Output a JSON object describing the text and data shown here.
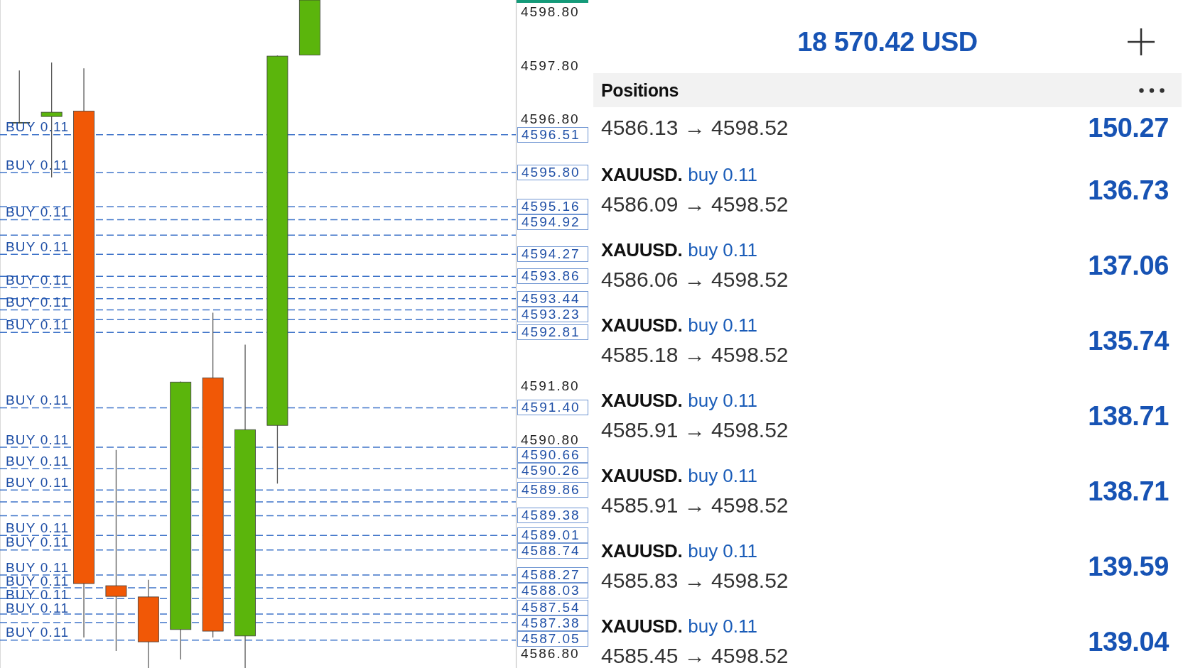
{
  "chart": {
    "chart_data": {
      "type": "candlestick",
      "categories": [
        null,
        null,
        null,
        null,
        null,
        null,
        null,
        null,
        null,
        null
      ],
      "ylim": [
        4586.53,
        4599.03
      ],
      "yticks": [
        {
          "value": 4598.8,
          "label": "4598.80"
        },
        {
          "value": 4597.8,
          "label": "4597.80"
        },
        {
          "value": 4596.8,
          "label": "4596.80"
        },
        {
          "value": 4591.8,
          "label": "4591.80"
        },
        {
          "value": 4590.8,
          "label": "4590.80"
        },
        {
          "value": 4586.8,
          "label": "4586.80"
        }
      ],
      "ref_lines": [
        {
          "axis": "y",
          "value": 4596.51,
          "label": "BUY 0.11"
        },
        {
          "axis": "y",
          "value": 4595.8,
          "label": "BUY 0.11"
        },
        {
          "axis": "y",
          "value": 4595.16
        },
        {
          "axis": "y",
          "value": 4594.92,
          "label": "BUY 0.11"
        },
        {
          "axis": "y",
          "value": 4594.63
        },
        {
          "axis": "y",
          "value": 4594.27,
          "label": "BUY 0.11"
        },
        {
          "axis": "y",
          "value": 4593.86
        },
        {
          "axis": "y",
          "value": 4593.65,
          "label": "BUY 0.11"
        },
        {
          "axis": "y",
          "value": 4593.44
        },
        {
          "axis": "y",
          "value": 4593.23,
          "label": "BUY 0.11"
        },
        {
          "axis": "y",
          "value": 4593.05
        },
        {
          "axis": "y",
          "value": 4592.81,
          "label": "BUY 0.11"
        },
        {
          "axis": "y",
          "value": 4591.4,
          "label": "BUY 0.11"
        },
        {
          "axis": "y",
          "value": 4590.66,
          "label": "BUY 0.11"
        },
        {
          "axis": "y",
          "value": 4590.26,
          "label": "BUY 0.11"
        },
        {
          "axis": "y",
          "value": 4589.86,
          "label": "BUY 0.11"
        },
        {
          "axis": "y",
          "value": 4589.64
        },
        {
          "axis": "y",
          "value": 4589.38
        },
        {
          "axis": "y",
          "value": 4589.01,
          "label": "BUY 0.11"
        },
        {
          "axis": "y",
          "value": 4588.74,
          "label": "BUY 0.11"
        },
        {
          "axis": "y",
          "value": 4588.27,
          "label": "BUY 0.11"
        },
        {
          "axis": "y",
          "value": 4588.03,
          "label": "BUY 0.11"
        },
        {
          "axis": "y",
          "value": 4587.83,
          "label": "BUY 0.11"
        },
        {
          "axis": "y",
          "value": 4587.54,
          "label": "BUY 0.11"
        },
        {
          "axis": "y",
          "value": 4587.38
        },
        {
          "axis": "y",
          "value": 4587.05,
          "label": "BUY 0.11"
        }
      ],
      "annotations": [
        "4596.51",
        "4595.80",
        "4595.16",
        "4594.92",
        "4594.27",
        "4593.86",
        "4593.44",
        "4593.23",
        "4592.81",
        "4591.40",
        "4590.66",
        "4590.26",
        "4589.86",
        "4589.38",
        "4589.01",
        "4588.74",
        "4588.27",
        "4588.03",
        "4587.54",
        "4587.38",
        "4587.05"
      ]
    }
  },
  "account": {
    "balance": "18 570.42 USD"
  },
  "positions": {
    "title": "Positions",
    "rows": [
      {
        "prices": "4586.13 → 4598.52",
        "profit": "150.27"
      },
      {
        "symbol": "XAUUSD.",
        "order": "buy 0.11",
        "prices": "4586.09 → 4598.52",
        "profit": "136.73"
      },
      {
        "symbol": "XAUUSD.",
        "order": "buy 0.11",
        "prices": "4586.06 → 4598.52",
        "profit": "137.06"
      },
      {
        "symbol": "XAUUSD.",
        "order": "buy 0.11",
        "prices": "4585.18 → 4598.52",
        "profit": "135.74"
      },
      {
        "symbol": "XAUUSD.",
        "order": "buy 0.11",
        "prices": "4585.91 → 4598.52",
        "profit": "138.71"
      },
      {
        "symbol": "XAUUSD.",
        "order": "buy 0.11",
        "prices": "4585.91 → 4598.52",
        "profit": "138.71"
      },
      {
        "symbol": "XAUUSD.",
        "order": "buy 0.11",
        "prices": "4585.83 → 4598.52",
        "profit": "139.59"
      },
      {
        "symbol": "XAUUSD.",
        "order": "buy 0.11",
        "prices": "4585.45 → 4598.52",
        "profit": "139.04"
      }
    ]
  }
}
